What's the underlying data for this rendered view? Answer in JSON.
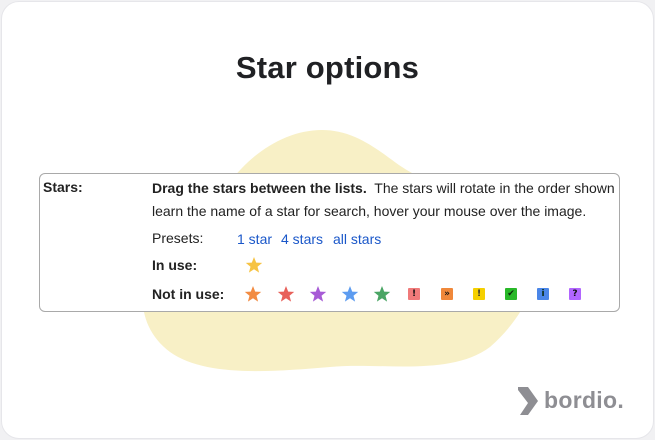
{
  "page": {
    "title": "Star options"
  },
  "settings": {
    "label": "Stars:",
    "instruction_bold": "Drag the stars between the lists.",
    "instruction_rest": "The stars will rotate in the order shown",
    "instruction_line2": "learn the name of a star for search, hover your mouse over the image.",
    "presets_label": "Presets:",
    "presets": [
      "1 star",
      "4 stars",
      "all stars"
    ],
    "in_use_label": "In use:",
    "not_in_use_label": "Not in use:",
    "in_use_icons": [
      {
        "icon": "yellow-star-icon",
        "color": "#f6c343"
      }
    ],
    "not_in_use_icons": [
      {
        "icon": "orange-star-icon",
        "color": "#f28b42"
      },
      {
        "icon": "red-star-icon",
        "color": "#e8605a"
      },
      {
        "icon": "purple-star-icon",
        "color": "#a75bd6"
      },
      {
        "icon": "blue-star-icon",
        "color": "#5d9cf0"
      },
      {
        "icon": "green-star-icon",
        "color": "#4aa564"
      },
      {
        "icon": "red-bang-icon",
        "color": "#f07a7a",
        "glyph": "!"
      },
      {
        "icon": "orange-guillemet-icon",
        "color": "#f0883a",
        "glyph": "»"
      },
      {
        "icon": "yellow-bang-icon",
        "color": "#f5d000",
        "glyph": "!"
      },
      {
        "icon": "green-check-icon",
        "color": "#28b828",
        "glyph": "✔"
      },
      {
        "icon": "blue-info-icon",
        "color": "#4a86e8",
        "glyph": "i"
      },
      {
        "icon": "purple-question-icon",
        "color": "#b266ff",
        "glyph": "?"
      }
    ]
  },
  "brand": {
    "name": "bordio."
  },
  "colors": {
    "link": "#1a57c9",
    "blob": "#f8f0c6",
    "brand_gray": "#8e8e93"
  }
}
